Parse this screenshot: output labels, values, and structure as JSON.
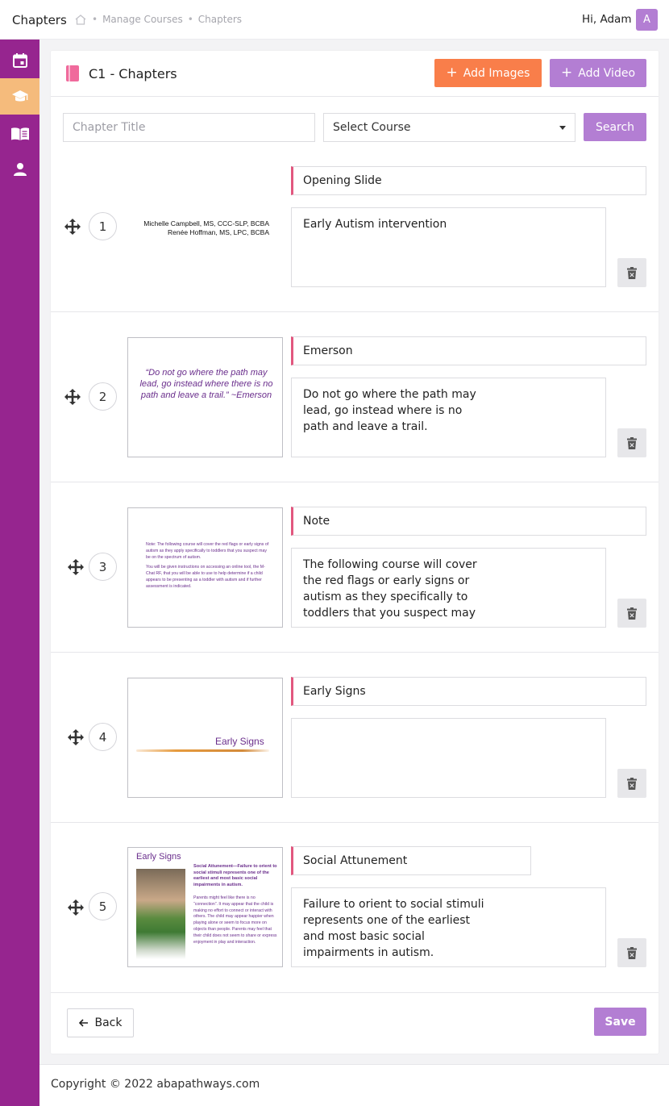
{
  "header": {
    "app_title": "Chapters",
    "breadcrumbs": [
      "Manage Courses",
      "Chapters"
    ],
    "greeting": "Hi, Adam",
    "avatar_letter": "A"
  },
  "sidebar": {
    "items": [
      {
        "icon": "calendar-icon",
        "active": false
      },
      {
        "icon": "graduation-cap-icon",
        "active": true
      },
      {
        "icon": "book-open-icon",
        "active": false
      },
      {
        "icon": "user-icon",
        "active": false
      }
    ],
    "colors": {
      "bg": "#96258f",
      "active": "#f5bb7c"
    }
  },
  "page": {
    "title": "C1 - Chapters",
    "add_images_label": "Add Images",
    "add_video_label": "Add Video"
  },
  "filters": {
    "chapter_title_placeholder": "Chapter Title",
    "course_select_value": "Select Course",
    "search_label": "Search"
  },
  "chapters": [
    {
      "number": "1",
      "title": "Opening Slide",
      "description": "Early Autism intervention",
      "thumb_text": [
        "Michelle Campbell, MS, CCC-SLP, BCBA",
        "Renée Hoffman, MS, LPC, BCBA"
      ]
    },
    {
      "number": "2",
      "title": "Emerson",
      "description": "Do not go where the path may lead, go instead where is no path and leave a trail.",
      "thumb_text": "“Do not go where the path may lead, go instead where there is no path and leave a trail.” ~Emerson"
    },
    {
      "number": "3",
      "title": "Note",
      "description": "The following course will cover the red flags or early signs or autism as they specifically to toddlers that you suspect may",
      "thumb_text": [
        "Note: The following course will cover the red flags or early signs of autism as they apply specifically to toddlers that you suspect may be on the spectrum of autism.",
        "You will be given instructions on accessing an online tool, the M-Chat RF, that you will be able to use to help determine if a child appears to be presenting as a toddler with autism and if further assessment is indicated."
      ]
    },
    {
      "number": "4",
      "title": "Early Signs",
      "description": "",
      "thumb_text": "Early Signs"
    },
    {
      "number": "5",
      "title": "Social Attunement",
      "description": "Failure to orient to social stimuli represents one of the earliest and most basic social impairments in autism.",
      "thumb_title": "Early Signs",
      "thumb_heading": "Social Attunement—Failure to orient to social stimuli represents one of the earliest and most basic social impairments in autism.",
      "thumb_body": "Parents might feel like there is no “connection”. It may appear that the child is making no effort to connect or interact with others. The child may appear happier when playing alone or seem to focus more on objects than people. Parents may feel that their child does not seem to share or express enjoyment in play and interaction."
    }
  ],
  "actions": {
    "back_label": "Back",
    "save_label": "Save"
  },
  "footer": {
    "copyright": "Copyright © 2022 abapathways.com"
  },
  "colors": {
    "accent_orange": "#f97e4a",
    "accent_purple": "#b37ed3",
    "title_bar": "#e2577f"
  }
}
